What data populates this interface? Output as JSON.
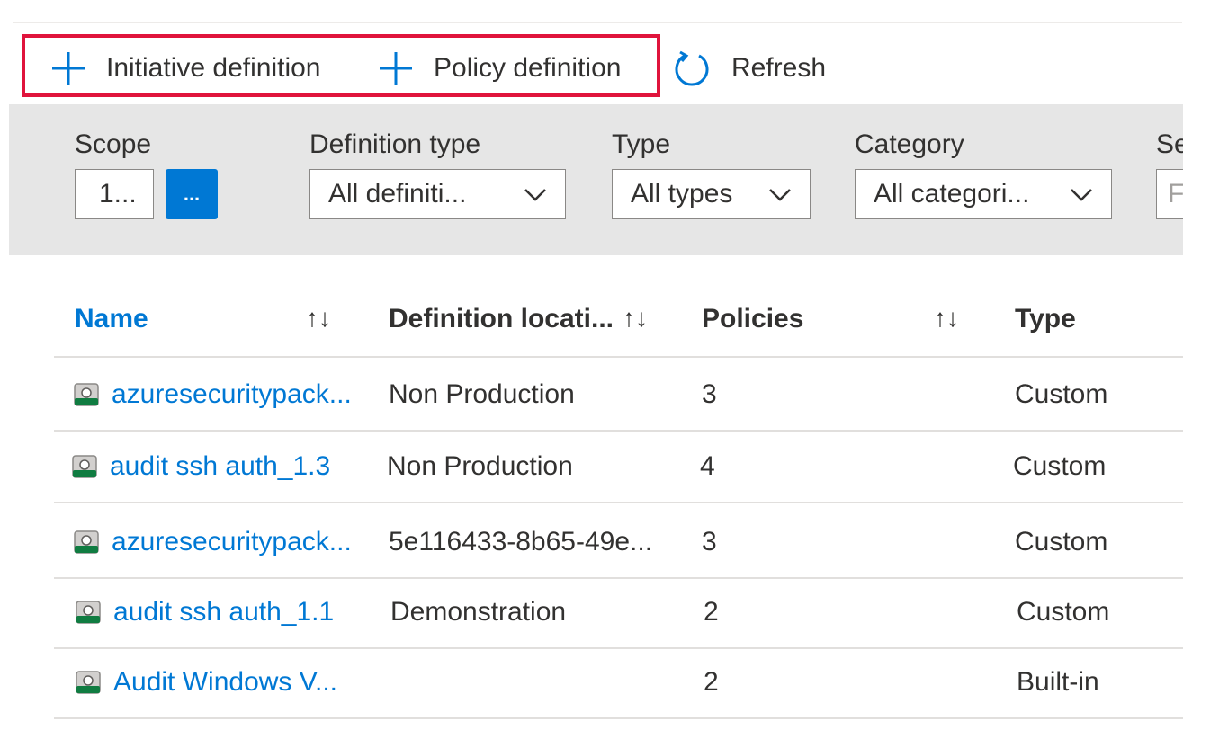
{
  "toolbar": {
    "initiative_label": "Initiative definition",
    "policy_label": "Policy definition",
    "refresh_label": "Refresh",
    "highlight_color": "#e0143c"
  },
  "filters": {
    "scope": {
      "label": "Scope",
      "value": "1...",
      "button_label": "..."
    },
    "definition_type": {
      "label": "Definition type",
      "value": "All definiti..."
    },
    "type": {
      "label": "Type",
      "value": "All types"
    },
    "category": {
      "label": "Category",
      "value": "All categori..."
    },
    "search": {
      "label": "Se",
      "value": "F"
    }
  },
  "table": {
    "headers": {
      "name": "Name",
      "definition_location": "Definition locati...",
      "policies": "Policies",
      "type": "Type",
      "sort_icon": "↑↓"
    },
    "rows": [
      {
        "name": "azuresecuritypack...",
        "location": "Non Production",
        "policies": "3",
        "type": "Custom"
      },
      {
        "name": "audit ssh auth_1.3",
        "location": "Non Production",
        "policies": "4",
        "type": "Custom"
      },
      {
        "name": "azuresecuritypack...",
        "location": "5e116433-8b65-49e...",
        "policies": "3",
        "type": "Custom"
      },
      {
        "name": "audit ssh auth_1.1",
        "location": "Demonstration",
        "policies": "2",
        "type": "Custom"
      },
      {
        "name": "Audit Windows V...",
        "location": "",
        "policies": "2",
        "type": "Built-in"
      }
    ]
  },
  "colors": {
    "accent": "#0078d4",
    "filter_band": "#e6e6e6"
  }
}
